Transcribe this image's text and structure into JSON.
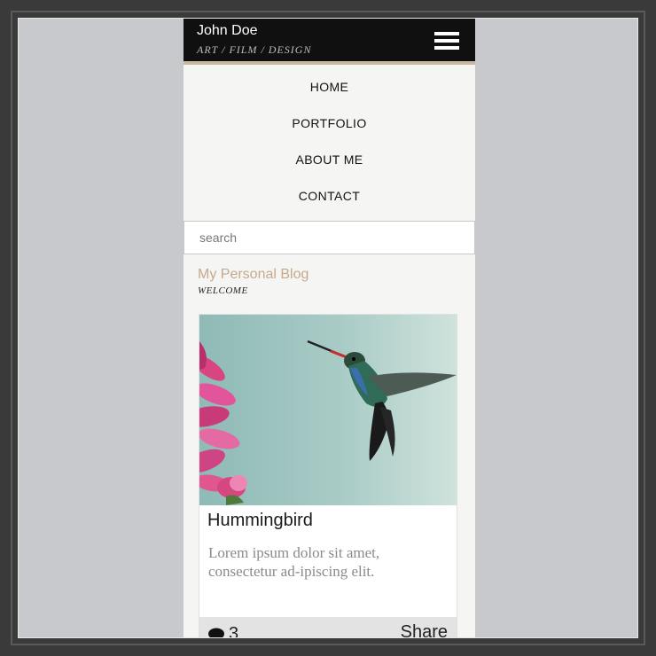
{
  "header": {
    "name": "John Doe",
    "tagline": "ART  /  FILM  /  DESIGN",
    "menu_icon": "hamburger-menu-icon"
  },
  "nav": {
    "items": [
      {
        "label": "HOME"
      },
      {
        "label": "PORTFOLIO"
      },
      {
        "label": "ABOUT ME"
      },
      {
        "label": "CONTACT"
      }
    ]
  },
  "search": {
    "placeholder": "search",
    "value": ""
  },
  "blog": {
    "title": "My Personal Blog",
    "subtitle": "WELCOME"
  },
  "post": {
    "image": "hummingbird-photo",
    "title": "Hummingbird",
    "excerpt": "Lorem ipsum dolor sit amet, consectetur ad-ipiscing elit.",
    "comment_count": "3",
    "comment_icon": "speech-bubble-icon",
    "share_label": "Share"
  },
  "colors": {
    "accent": "#c6a98a",
    "topbar": "#101010",
    "page_bg": "#c8c9cc"
  }
}
